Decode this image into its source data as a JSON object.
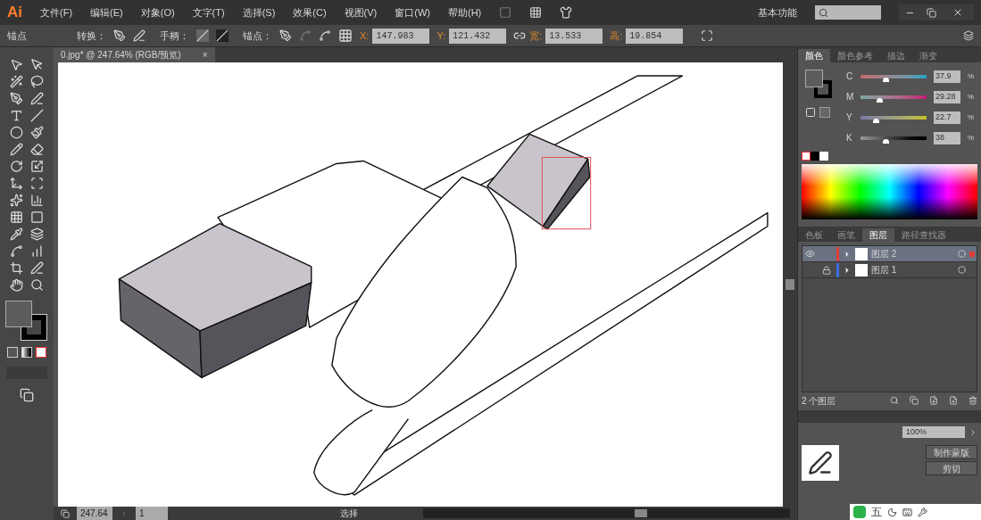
{
  "app": {
    "logo": "Ai",
    "menu": [
      "文件(F)",
      "编辑(E)",
      "对象(O)",
      "文字(T)",
      "选择(S)",
      "效果(C)",
      "视图(V)",
      "窗口(W)",
      "帮助(H)"
    ],
    "workspace": "基本功能"
  },
  "control_bar": {
    "selection_label": "锚点",
    "convert_label": "转换：",
    "handles_label": "手柄：",
    "anchors_label": "锚点：",
    "fields": [
      {
        "label": "X:",
        "value": "147.983"
      },
      {
        "label": "Y:",
        "value": "121.432"
      },
      {
        "label": "宽:",
        "value": "13.533"
      },
      {
        "label": "高:",
        "value": "19.854"
      }
    ]
  },
  "document_tab": {
    "title": "0.jpg* @ 247.64% (RGB/预览)",
    "close": "×"
  },
  "color_panel": {
    "tabs": [
      {
        "label": "颜色",
        "selected": true
      },
      {
        "label": "颜色参考",
        "selected": false
      },
      {
        "label": "描边",
        "selected": false
      },
      {
        "label": "渐变",
        "selected": false
      }
    ],
    "channels": [
      {
        "label": "C",
        "value": "37.9",
        "level": 0.38
      },
      {
        "label": "M",
        "value": "29.28",
        "level": 0.29
      },
      {
        "label": "Y",
        "value": "22.7",
        "level": 0.23
      },
      {
        "label": "K",
        "value": "38",
        "level": 0.38
      }
    ],
    "unit": "%"
  },
  "layers_panel": {
    "tabs": [
      {
        "label": "色板",
        "selected": false
      },
      {
        "label": "画笔",
        "selected": false
      },
      {
        "label": "图层",
        "selected": true
      },
      {
        "label": "路径查找器",
        "selected": false
      }
    ],
    "layers": [
      {
        "name": "图层 2",
        "selected": true,
        "visible": true,
        "locked": false,
        "color": "#e03c3c"
      },
      {
        "name": "图层 1",
        "selected": false,
        "visible": false,
        "locked": true,
        "color": "#3c6fe0"
      }
    ],
    "footer": "2 个图层"
  },
  "transparency_panel": {
    "opacity": "100%",
    "buttons": [
      "制作蒙版",
      "剪切"
    ]
  },
  "status_bar": {
    "zoom": "247.64",
    "page": "1",
    "tool": "选择"
  },
  "ime": {
    "mode": "五"
  }
}
